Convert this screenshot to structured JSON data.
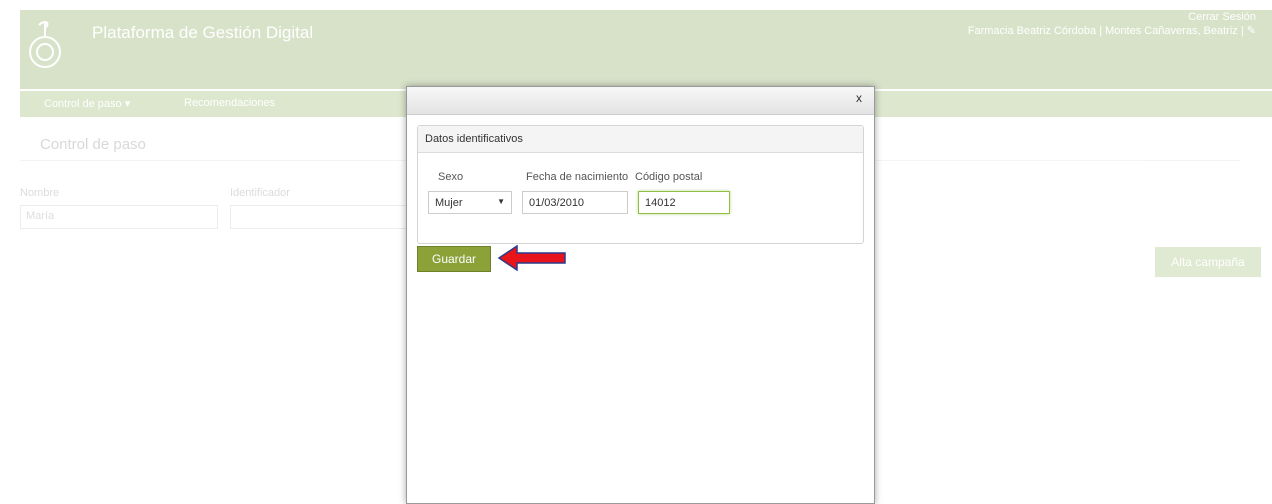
{
  "app": {
    "brand": "Plataforma de Gestión Digital",
    "logout": "Cerrar Sesión",
    "user_info": "Farmacia Beatriz Córdoba | Montes Cañaveras, Beatriz |",
    "nav": {
      "control": "Control de paso ▾",
      "recommendations": "Recomendaciones"
    },
    "section_title": "Control de paso",
    "fields": {
      "name_label": "Nombre",
      "name_value": "María",
      "id_label": "Identificador"
    },
    "alta_button": "Alta campaña"
  },
  "modal": {
    "close": "x",
    "panel_heading": "Datos identificativos",
    "sexo_label": "Sexo",
    "sexo_value": "Mujer",
    "fecha_label": "Fecha de nacimiento",
    "fecha_value": "01/03/2010",
    "cp_label": "Código postal",
    "cp_value": "14012",
    "save_button": "Guardar"
  },
  "colors": {
    "brand_green": "#a9bf8a",
    "save_green": "#8ca138",
    "arrow_red": "#e8141b"
  },
  "icons": {
    "logo": "pharmacy-logo-icon",
    "edit": "edit-icon",
    "select_arrow": "caret-down-icon",
    "annotation_arrow": "red-arrow-left-icon"
  }
}
